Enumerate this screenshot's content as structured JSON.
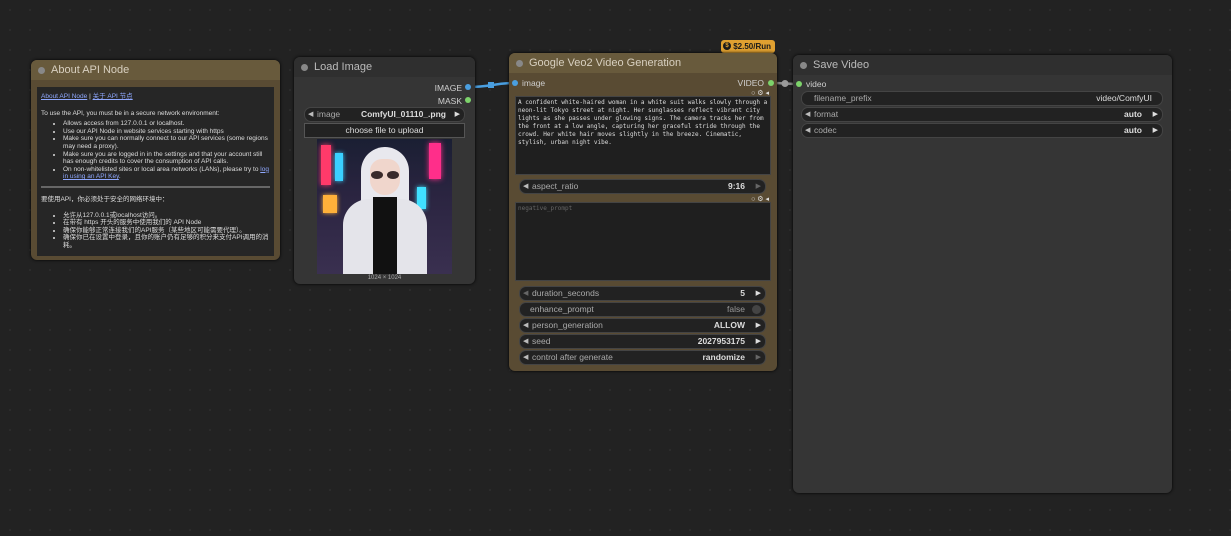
{
  "colors": {
    "canvas": "#222222",
    "link_blue": "#4a9fe0",
    "link_green": "#8a8a8a",
    "port_video": "#7dd36b",
    "badge": "#e0a030"
  },
  "about_node": {
    "title": "About API Node",
    "link_en": "About API Node",
    "separator": " | ",
    "link_cn": "关于 API 节点",
    "intro": "To use the API, you must be in a secure network environment:",
    "bullets": [
      "Allows access from 127.0.0.1 or localhost.",
      "Use our API Node in website services starting with https",
      "Make sure you can normally connect to our API services (some regions may need a proxy).",
      "Make sure you are logged in in the settings and that your account still has enough credits to cover the consumption of API calls.",
      "On non-whitelisted sites or local area networks (LANs), please try to"
    ],
    "bullet_link": "log in using an API Key",
    "bullet_link_end": ".",
    "intro_cn": "要使用API，你必须处于安全的网络环境中：",
    "bullets_cn": [
      "允许从127.0.0.1或localhost访问。",
      "在带有 https 开头的服务中使用我们的 API Node",
      "确保你能够正常连接我们的API服务（某些地区可能需要代理）。",
      "确保你已在设置中登录，且你的账户仍有足够的积分来支付API调用的消耗。"
    ]
  },
  "load_image": {
    "title": "Load Image",
    "out_image": "IMAGE",
    "out_mask": "MASK",
    "image_label": "image",
    "image_value": "ComfyUI_01110_.png",
    "upload_label": "choose file to upload",
    "dims": "1024 × 1024"
  },
  "veo": {
    "badge": "$2.50/Run",
    "title": "Google Veo2 Video Generation",
    "in_image": "image",
    "out_video": "VIDEO",
    "prompt": "A confident white-haired woman in a white suit walks slowly through a neon-lit Tokyo street at night. Her sunglasses reflect vibrant city lights as she passes under glowing signs. The camera tracks her from the front at a low angle, capturing her graceful stride through the crowd. Her white hair moves slightly in the breeze. Cinematic, stylish, urban night vibe.",
    "aspect_label": "aspect_ratio",
    "aspect_value": "9:16",
    "negative_placeholder": "negative_prompt",
    "duration_label": "duration_seconds",
    "duration_value": "5",
    "enhance_label": "enhance_prompt",
    "enhance_value": "false",
    "person_label": "person_generation",
    "person_value": "ALLOW",
    "seed_label": "seed",
    "seed_value": "2027953175",
    "control_label": "control after generate",
    "control_value": "randomize"
  },
  "save_video": {
    "title": "Save Video",
    "in_video": "video",
    "prefix_label": "filename_prefix",
    "prefix_value": "video/ComfyUI",
    "format_label": "format",
    "format_value": "auto",
    "codec_label": "codec",
    "codec_value": "auto"
  }
}
